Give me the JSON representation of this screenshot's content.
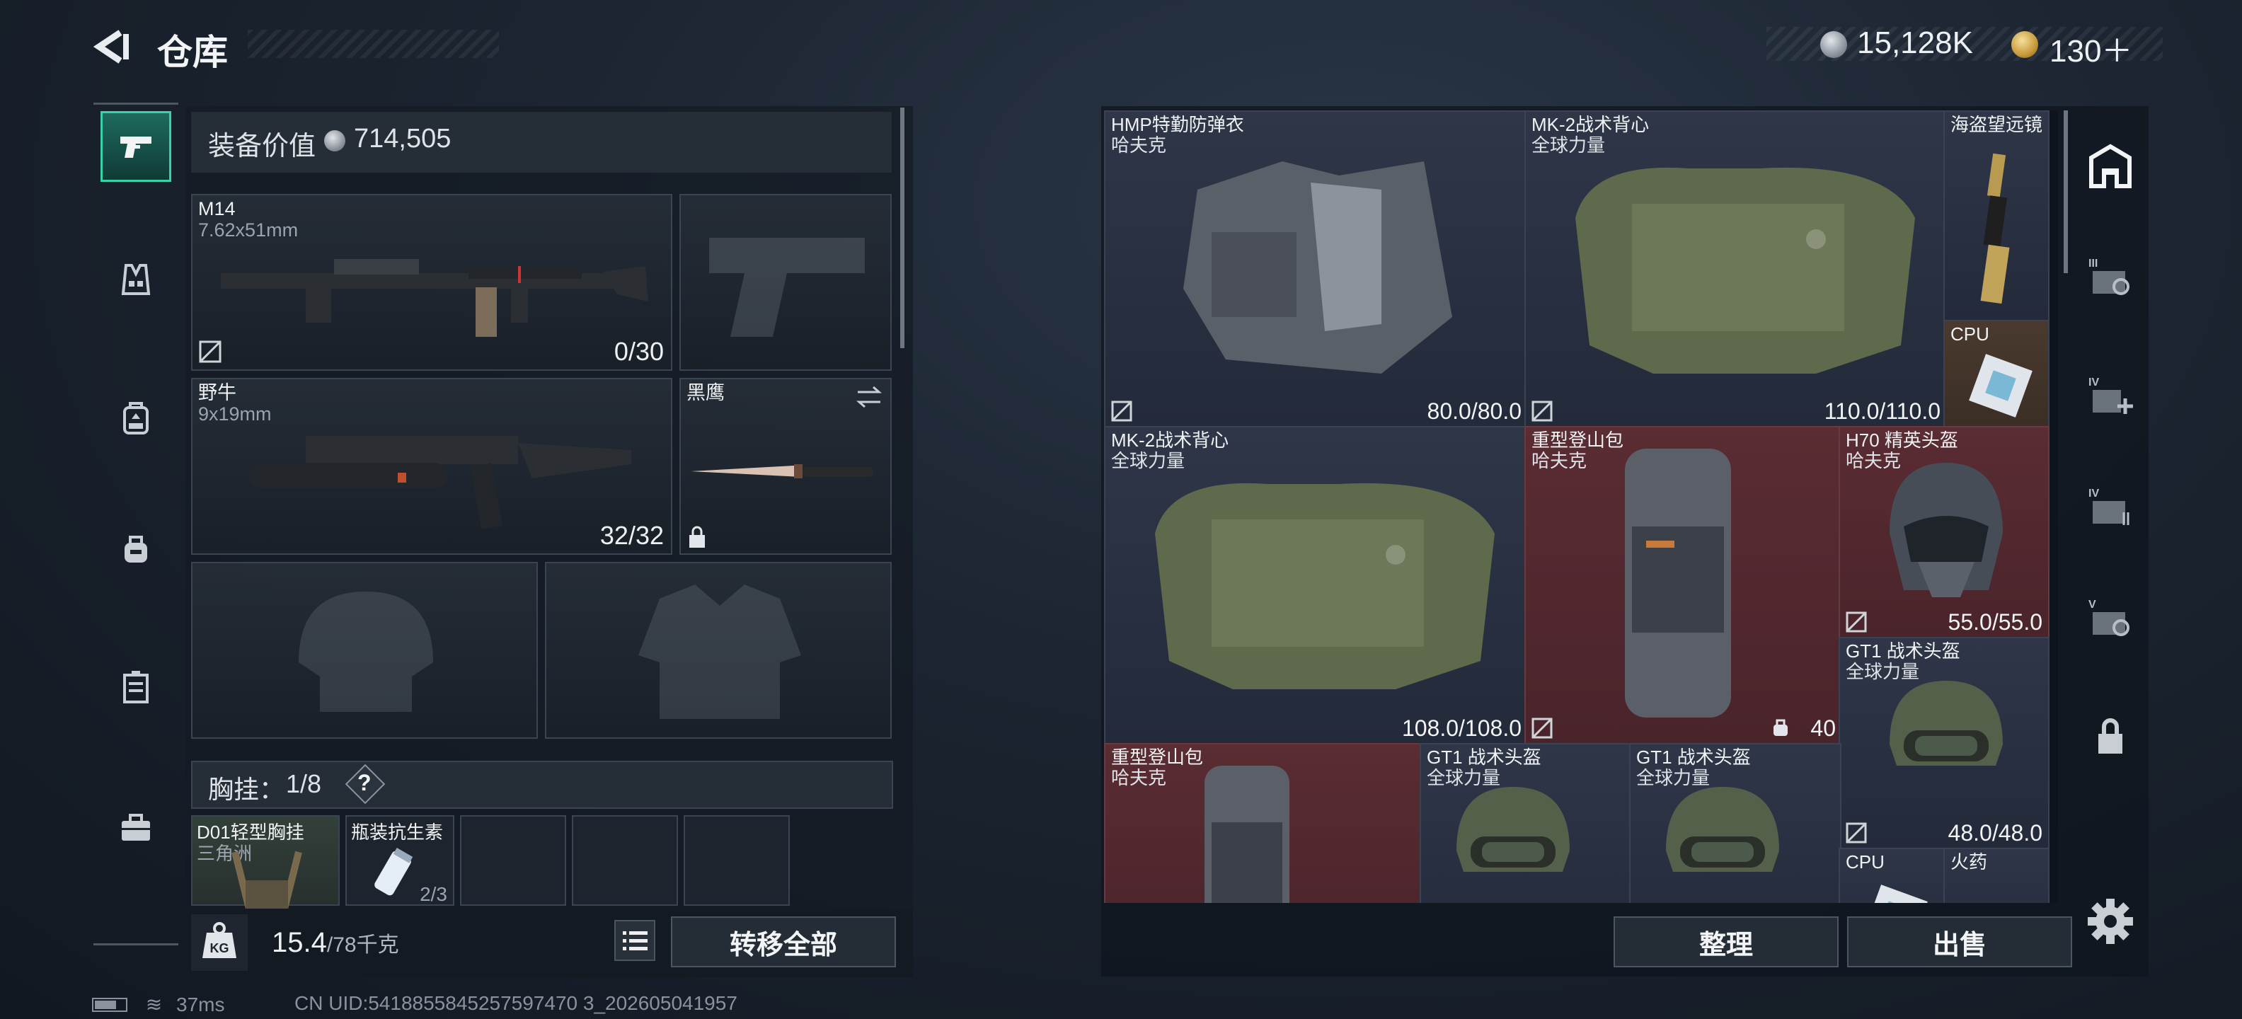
{
  "header": {
    "title": "仓库",
    "back_icon": "chevron-left-icon"
  },
  "currency": {
    "silver": "15,128K",
    "gold": "130＋",
    "silver_icon": "silver-coin-icon",
    "gold_icon": "gold-coin-icon"
  },
  "sidebar": {
    "items": [
      {
        "icon": "pistol-icon",
        "active": true
      },
      {
        "icon": "vest-icon",
        "active": false
      },
      {
        "icon": "backpack-icon",
        "active": false
      },
      {
        "icon": "bag-icon",
        "active": false
      },
      {
        "icon": "case-icon",
        "active": false
      },
      {
        "icon": "briefcase-icon",
        "active": false
      }
    ]
  },
  "equipment": {
    "value_label": "装备价值",
    "value": "714,505",
    "primary": {
      "name": "M14",
      "caliber": "7.62x51mm",
      "ammo": "0/30"
    },
    "secondary": {
      "name": "野牛",
      "caliber": "9x19mm",
      "ammo": "32/32"
    },
    "melee": {
      "name": "黑鹰"
    },
    "chest_label": "胸挂：",
    "chest_count": "1/8",
    "chest_help": "?",
    "small_slots": [
      {
        "name": "D01轻型胸挂",
        "sub": "三角洲"
      },
      {
        "name": "瓶装抗生素",
        "sub": "2/3"
      }
    ],
    "weight": "15.4",
    "weight_unit": "/78千克",
    "weight_icon": "KG",
    "transfer_all": "转移全部"
  },
  "storage": {
    "items": [
      {
        "name": "HMP特勤防弹衣",
        "sub": "哈夫克",
        "durability": "80.0/80.0",
        "rarity": "blue"
      },
      {
        "name": "MK-2战术背心",
        "sub": "全球力量",
        "durability": "110.0/110.0",
        "rarity": "blue"
      },
      {
        "name": "海盗望远镜",
        "sub": "",
        "durability": "",
        "rarity": "blue"
      },
      {
        "name": "CPU",
        "sub": "",
        "durability": "",
        "rarity": "brown"
      },
      {
        "name": "MK-2战术背心",
        "sub": "全球力量",
        "durability": "108.0/108.0",
        "rarity": "blue"
      },
      {
        "name": "重型登山包",
        "sub": "哈夫克",
        "durability": "40",
        "rarity": "red"
      },
      {
        "name": "H70 精英头盔",
        "sub": "哈夫克",
        "durability": "55.0/55.0",
        "rarity": "red"
      },
      {
        "name": "GT1 战术头盔",
        "sub": "全球力量",
        "durability": "48.0/48.0",
        "rarity": "blue"
      },
      {
        "name": "重型登山包",
        "sub": "哈夫克",
        "durability": "",
        "rarity": "red"
      },
      {
        "name": "GT1 战术头盔",
        "sub": "全球力量",
        "durability": "",
        "rarity": "blue"
      },
      {
        "name": "GT1 战术头盔",
        "sub": "全球力量",
        "durability": "",
        "rarity": "blue"
      },
      {
        "name": "CPU",
        "sub": "",
        "durability": "",
        "rarity": "blue"
      },
      {
        "name": "火药",
        "sub": "",
        "durability": "",
        "rarity": "blue"
      }
    ],
    "sort_label": "整理",
    "sell_label": "出售"
  },
  "right_sidebar": {
    "items": [
      {
        "icon": "storage-icon"
      },
      {
        "icon": "locker-iii-icon"
      },
      {
        "icon": "locker-iv-add-icon"
      },
      {
        "icon": "locker-iv-icon"
      },
      {
        "icon": "locker-v-icon"
      },
      {
        "icon": "lock-icon"
      },
      {
        "icon": "gear-icon"
      }
    ]
  },
  "status": {
    "ping": "37ms",
    "uid": "CN UID:5418855845257597470 3_202605041957"
  }
}
